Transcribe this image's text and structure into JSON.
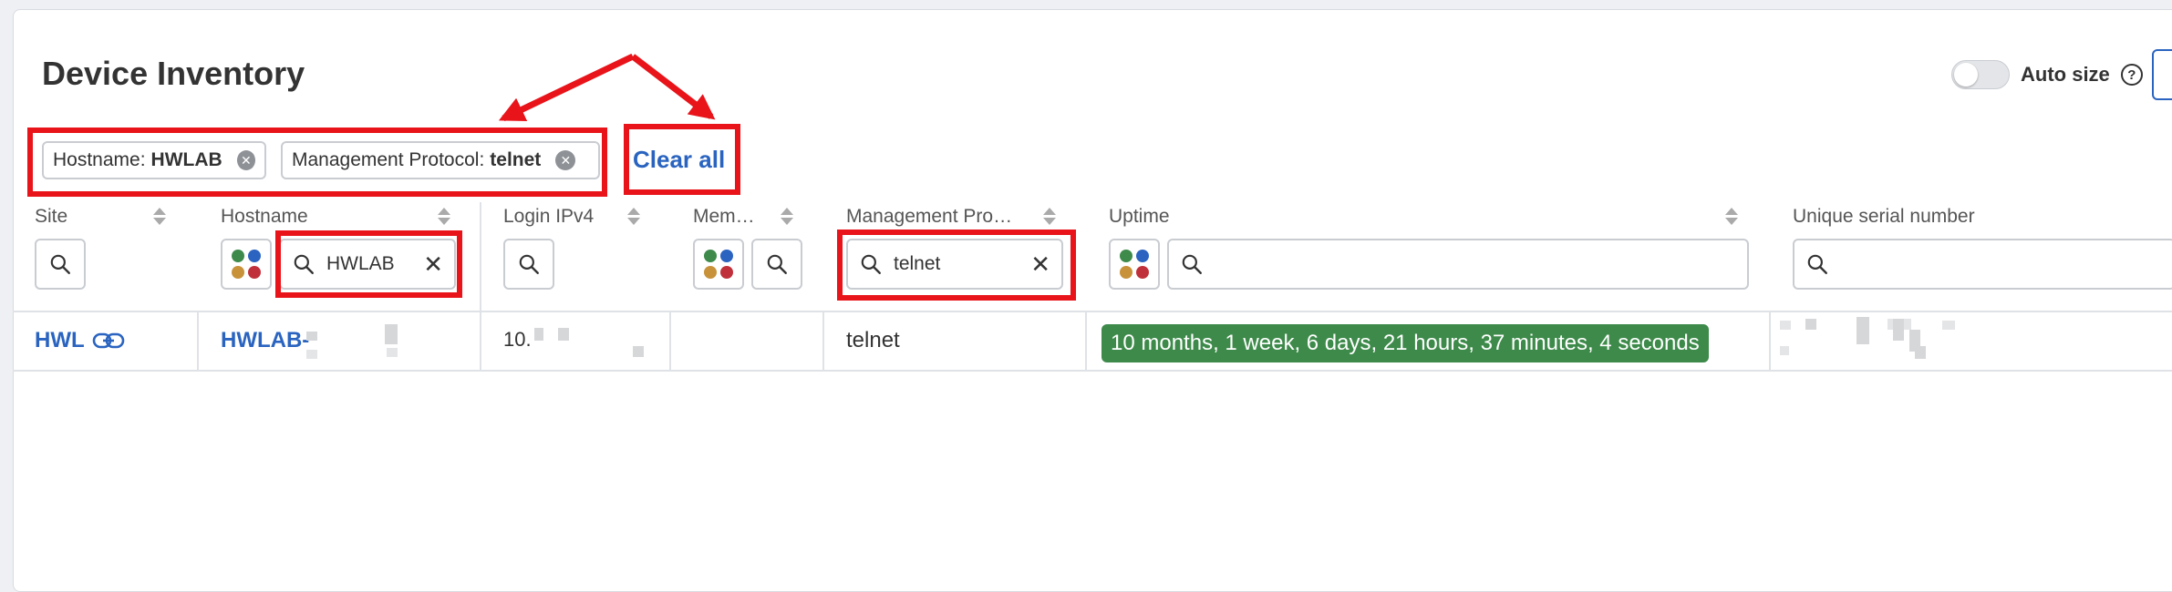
{
  "page": {
    "title": "Device Inventory"
  },
  "toolbar": {
    "auto_size_label": "Auto size",
    "help_icon": "?"
  },
  "filters": {
    "chips": [
      {
        "field": "Hostname:",
        "value": "HWLAB"
      },
      {
        "field": "Management Protocol:",
        "value": "telnet"
      }
    ],
    "clear_all_label": "Clear all"
  },
  "columns": [
    {
      "label": "Site"
    },
    {
      "label": "Hostname",
      "search_value": "HWLAB"
    },
    {
      "label": "Login IPv4"
    },
    {
      "label": "Mem…"
    },
    {
      "label": "Management Pro…",
      "search_value": "telnet"
    },
    {
      "label": "Uptime"
    },
    {
      "label": "Unique serial number"
    }
  ],
  "rows": [
    {
      "site": "HWL",
      "hostname": "HWLAB-",
      "login_ipv4": "10.",
      "management_protocol": "telnet",
      "uptime": "10 months, 1 week, 6 days, 21 hours, 37 minutes, 4 seconds"
    }
  ],
  "colors": {
    "accent": "#2a64c0",
    "uptime_badge": "#3d8a4a",
    "highlight": "#e8141a"
  },
  "icons": {
    "search": "search-icon",
    "clear": "close-icon",
    "link": "link-icon",
    "color_filter": "color-dots-icon",
    "sort": "sort-icon"
  }
}
